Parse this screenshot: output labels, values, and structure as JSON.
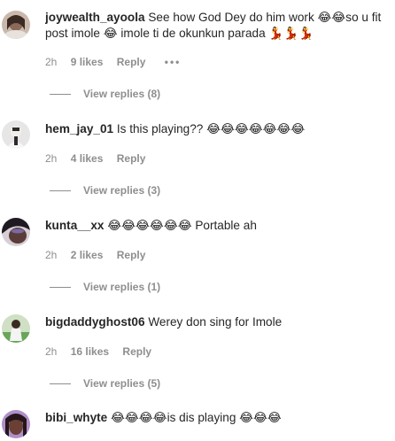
{
  "comments": [
    {
      "username": "joywealth_ayoola",
      "text_line1": "See how God Dey do him work 😂😂so u fit",
      "text_line2": "post imole 😂 imole ti de okunkun parada 💃💃💃",
      "time": "2h",
      "likes": "9 likes",
      "reply": "Reply",
      "more": "•••",
      "view_replies": "View replies (8)"
    },
    {
      "username": "hem_jay_01",
      "text_line1": "Is this playing?? 😂😂😂😂😂😂😂",
      "time": "2h",
      "likes": "4 likes",
      "reply": "Reply",
      "view_replies": "View replies (3)"
    },
    {
      "username": "kunta__xx",
      "text_line1": "😂😂😂😂😂😂 Portable ah",
      "time": "2h",
      "likes": "2 likes",
      "reply": "Reply",
      "view_replies": "View replies (1)"
    },
    {
      "username": "bigdaddyghost06",
      "text_line1": "Werey don sing for Imole",
      "time": "2h",
      "likes": "16 likes",
      "reply": "Reply",
      "view_replies": "View replies (5)"
    },
    {
      "username": "bibi_whyte",
      "text_line1": "😂😂😂😂is dis playing 😂😂😂"
    }
  ],
  "colors": {
    "text": "#262626",
    "secondary": "#8e8e8e",
    "background": "#ffffff"
  }
}
